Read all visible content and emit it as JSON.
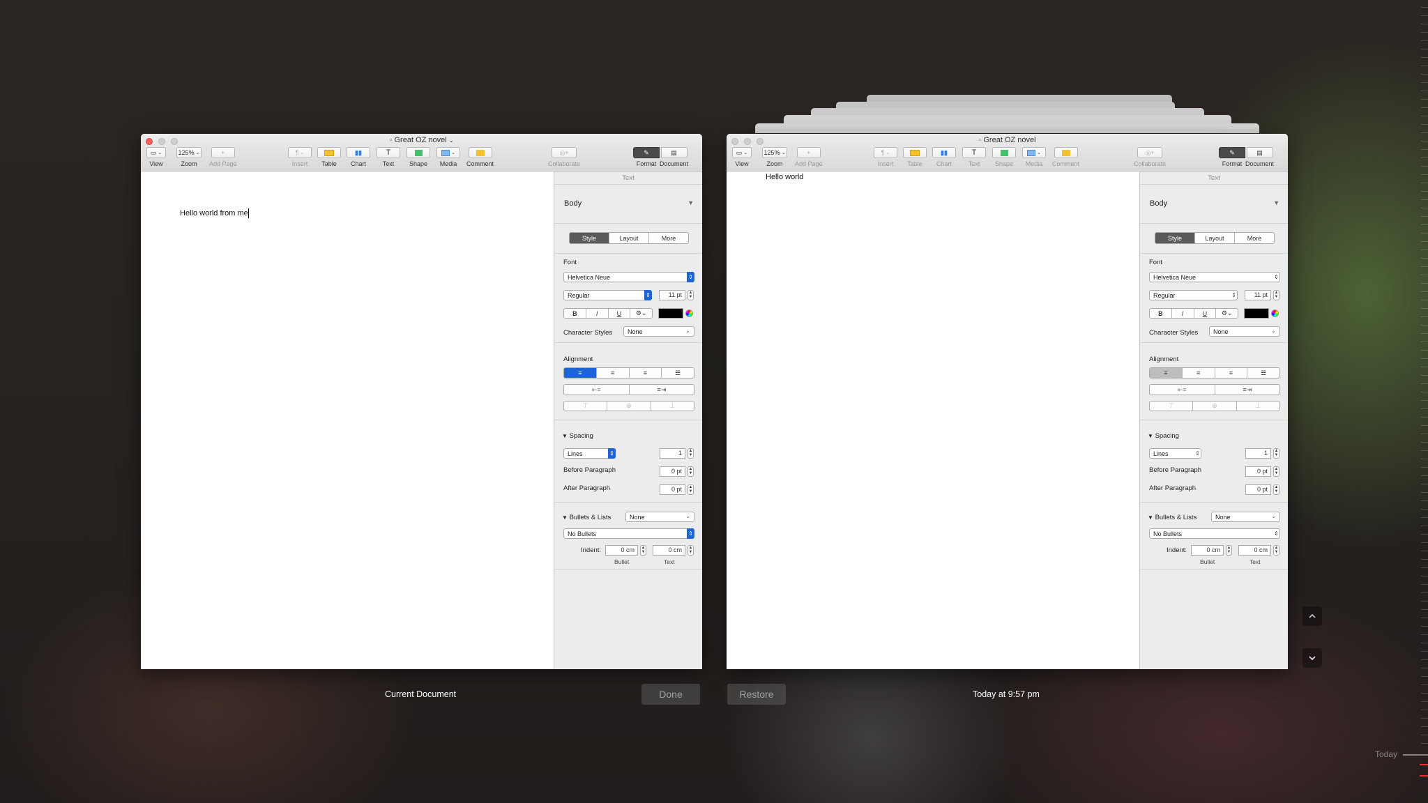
{
  "left_window": {
    "title": "Great OZ novel",
    "toolbar": {
      "view": "View",
      "zoom": "Zoom",
      "zoom_value": "125%",
      "add_page": "Add Page",
      "insert": "Insert",
      "table": "Table",
      "chart": "Chart",
      "text": "Text",
      "shape": "Shape",
      "media": "Media",
      "comment": "Comment",
      "collaborate": "Collaborate",
      "format": "Format",
      "document": "Document"
    },
    "body_text": "Hello world from me",
    "inspector": {
      "header": "Text",
      "paragraph_style": "Body",
      "tabs": [
        "Style",
        "Layout",
        "More"
      ],
      "font_label": "Font",
      "font_name": "Helvetica Neue",
      "font_weight": "Regular",
      "font_size": "11 pt",
      "bold": "B",
      "italic": "I",
      "underline": "U",
      "char_styles_label": "Character Styles",
      "char_styles_value": "None",
      "alignment_label": "Alignment",
      "spacing_label": "Spacing",
      "spacing_mode": "Lines",
      "spacing_value": "1",
      "before_paragraph_label": "Before Paragraph",
      "before_paragraph_value": "0 pt",
      "after_paragraph_label": "After Paragraph",
      "after_paragraph_value": "0 pt",
      "bullets_label": "Bullets & Lists",
      "bullets_value": "None",
      "bullet_type": "No Bullets",
      "indent_label": "Indent:",
      "indent_bullet_value": "0 cm",
      "indent_text_value": "0 cm",
      "indent_bullet_caption": "Bullet",
      "indent_text_caption": "Text"
    }
  },
  "right_window": {
    "title": "Great OZ novel",
    "toolbar": {
      "view": "View",
      "zoom": "Zoom",
      "zoom_value": "125%",
      "add_page": "Add Page",
      "insert": "Insert",
      "table": "Table",
      "chart": "Chart",
      "text": "Text",
      "shape": "Shape",
      "media": "Media",
      "comment": "Comment",
      "collaborate": "Collaborate",
      "format": "Format",
      "document": "Document"
    },
    "body_text": "Hello world",
    "inspector": {
      "header": "Text",
      "paragraph_style": "Body",
      "tabs": [
        "Style",
        "Layout",
        "More"
      ],
      "font_label": "Font",
      "font_name": "Helvetica Neue",
      "font_weight": "Regular",
      "font_size": "11 pt",
      "bold": "B",
      "italic": "I",
      "underline": "U",
      "char_styles_label": "Character Styles",
      "char_styles_value": "None",
      "alignment_label": "Alignment",
      "spacing_label": "Spacing",
      "spacing_mode": "Lines",
      "spacing_value": "1",
      "before_paragraph_label": "Before Paragraph",
      "before_paragraph_value": "0 pt",
      "after_paragraph_label": "After Paragraph",
      "after_paragraph_value": "0 pt",
      "bullets_label": "Bullets & Lists",
      "bullets_value": "None",
      "bullet_type": "No Bullets",
      "indent_label": "Indent:",
      "indent_bullet_value": "0 cm",
      "indent_text_value": "0 cm",
      "indent_bullet_caption": "Bullet",
      "indent_text_caption": "Text"
    }
  },
  "footer": {
    "current_label": "Current Document",
    "done_button": "Done",
    "restore_button": "Restore",
    "version_label": "Today at 9:57 pm"
  },
  "timeline": {
    "today_label": "Today"
  },
  "colors": {
    "accent_blue": "#1c64d8",
    "close_red": "#fc605b"
  }
}
